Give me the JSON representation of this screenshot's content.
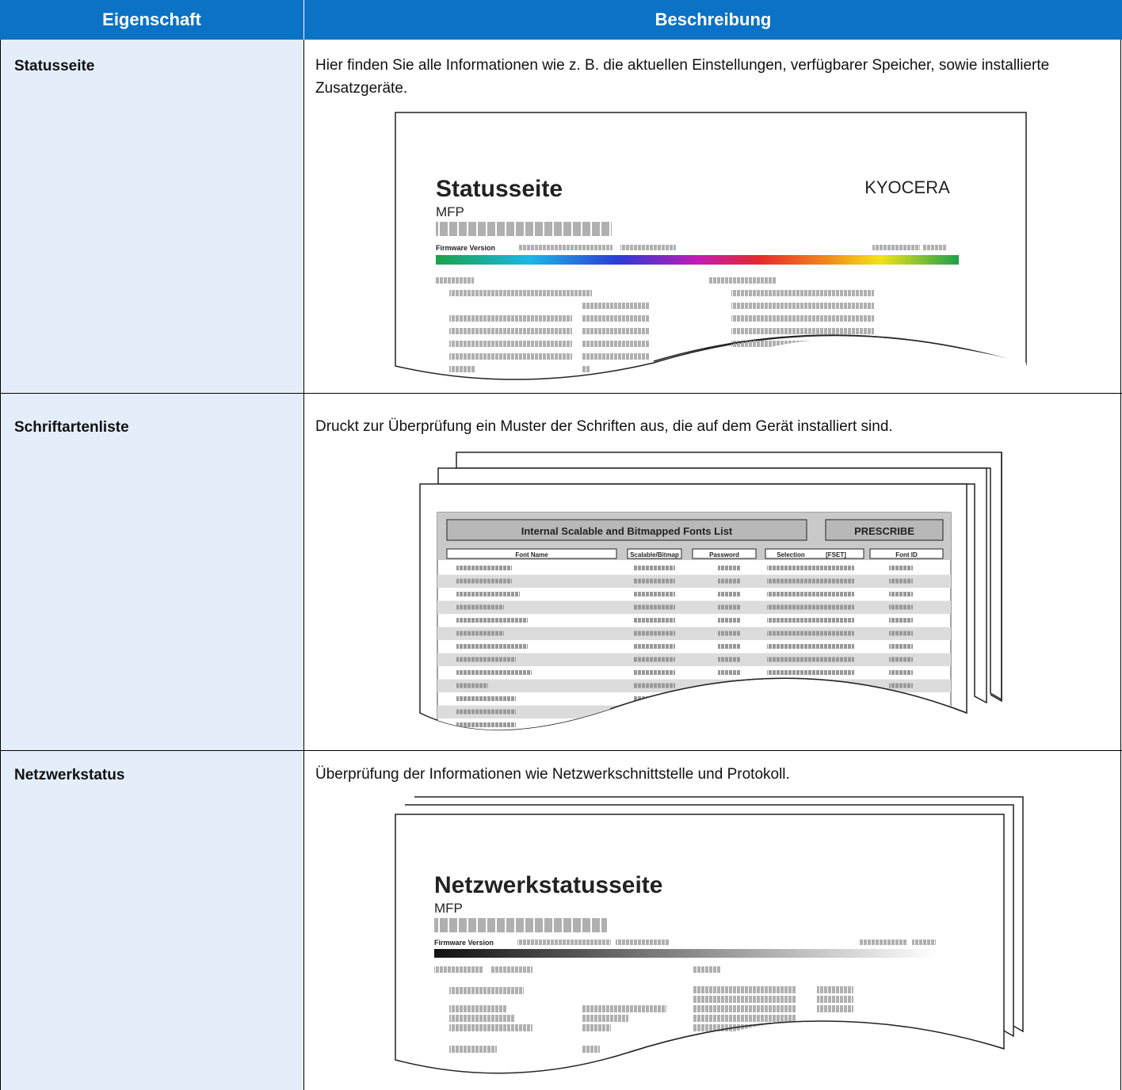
{
  "header": {
    "col1": "Eigenschaft",
    "col2": "Beschreibung"
  },
  "rows": [
    {
      "property": "Statusseite",
      "description": "Hier finden Sie alle Informationen wie z. B. die aktuellen Einstellungen, verfügbarer Speicher, sowie installierte Zusatzgeräte.",
      "illustration": {
        "title": "Statusseite",
        "subtitle": "MFP",
        "firmware_label": "Firmware Version",
        "logo": "KYOCERA"
      }
    },
    {
      "property": "Schriftartenliste",
      "description": "Druckt zur Überprüfung ein Muster der Schriften aus, die auf dem Gerät installiert sind.",
      "illustration": {
        "banner": "Internal Scalable and Bitmapped Fonts List",
        "banner_right": "PRESCRIBE",
        "columns": [
          "Font Name",
          "Scalable/Bitmap",
          "Password",
          "Selection",
          "[FSET]",
          "Font ID"
        ]
      }
    },
    {
      "property": "Netzwerkstatus",
      "description": "Überprüfung der Informationen wie Netzwerkschnittstelle und Protokoll.",
      "illustration": {
        "title": "Netzwerkstatusseite",
        "subtitle": "MFP",
        "firmware_label": "Firmware Version"
      }
    }
  ],
  "colors": {
    "header_bg": "#0b72c6",
    "property_bg": "#e4eefb",
    "placeholder_gray": "#b0b0b0"
  }
}
